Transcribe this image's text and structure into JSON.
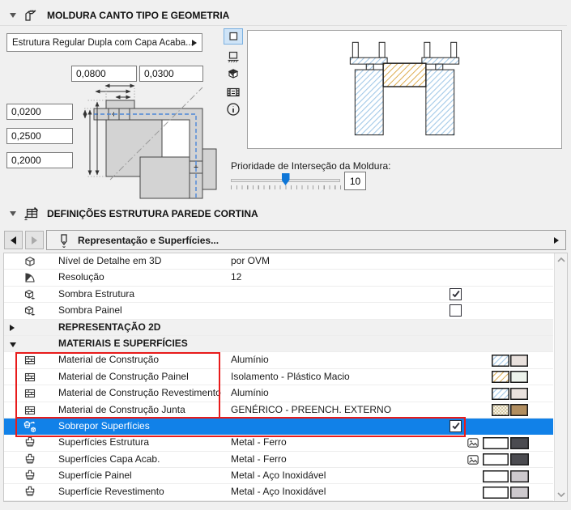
{
  "panel_moldura": {
    "title": "MOLDURA CANTO TIPO E GEOMETRIA",
    "type_selector": "Estrutura Regular Dupla com Capa Acaba...",
    "inputs": {
      "frame_width": "0,0800",
      "frame_thickness": "0,0300",
      "corner_offset": "0,0200",
      "corner_height": "0,2500",
      "corner_depth": "0,2000"
    },
    "priority": {
      "label": "Prioridade de Interseção da Moldura:",
      "value": "10",
      "percent": 50
    }
  },
  "panel_definicoes": {
    "title": "DEFINIÇÕES ESTRUTURA PAREDE CORTINA",
    "nav": {
      "label": "Representação e Superfícies..."
    },
    "table": {
      "rows": [
        {
          "icon": "cube-outline",
          "label": "Nível de Detalhe em 3D",
          "value": "por OVM"
        },
        {
          "icon": "resolution-cone",
          "label": "Resolução",
          "value": "12"
        },
        {
          "icon": "cube-shadow",
          "label": "Sombra Estrutura",
          "checkbox": true
        },
        {
          "icon": "cube-shadow",
          "label": "Sombra Painel",
          "checkbox": false
        },
        {
          "group": "collapsed",
          "label": "REPRESENTAÇÃO 2D"
        },
        {
          "group": "expanded",
          "label": "MATERIAIS E SUPERFÍCIES"
        },
        {
          "icon": "building-material",
          "label": "Material de Construção",
          "value": "Alumínio",
          "swatches": [
            "hatch-blue",
            "aluminio"
          ]
        },
        {
          "icon": "building-material",
          "label": "Material de Construção Painel",
          "value": "Isolamento - Plástico Macio",
          "swatches": [
            "hatch-orange",
            "isolamento"
          ]
        },
        {
          "icon": "building-material",
          "label": "Material de Construção Revestimento",
          "value": "Alumínio",
          "swatches": [
            "hatch-blue",
            "aluminio"
          ]
        },
        {
          "icon": "building-material",
          "label": "Material de Construção Junta",
          "value": "GENÉRICO - PREENCH. EXTERNO",
          "swatches": [
            "hatch-junta",
            "junta"
          ]
        },
        {
          "icon": "override-surfaces",
          "label": "Sobrepor Superfícies",
          "checkbox": true,
          "selected": true
        },
        {
          "icon": "paintbrush",
          "label": "Superfícies Estrutura",
          "value": "Metal - Ferro",
          "texture": true,
          "surface": [
            "white",
            "ferro"
          ]
        },
        {
          "icon": "paintbrush",
          "label": "Superfícies Capa Acab.",
          "value": "Metal - Ferro",
          "texture": true,
          "surface": [
            "white",
            "ferro"
          ]
        },
        {
          "icon": "paintbrush",
          "label": "Superfície Painel",
          "value": "Metal - Aço Inoxidável",
          "surface": [
            "white",
            "inox"
          ]
        },
        {
          "icon": "paintbrush",
          "label": "Superfície Revestimento",
          "value": "Metal - Aço Inoxidável",
          "surface": [
            "white",
            "inox"
          ]
        }
      ]
    }
  },
  "colors": {
    "selection_blue": "#1181e8",
    "annotation_red": "#e81b1b",
    "hatch_blue": "#a3c9e8",
    "hatch_orange": "#d9a23a",
    "swatch_aluminio": "#e9e1dd",
    "swatch_isolamento": "#edf3ec",
    "swatch_junta_hatch": "#d5c9a4",
    "swatch_junta": "#b18e60",
    "swatch_ferro": "#4b4b50",
    "swatch_inox": "#cdc9cd",
    "swatch_white": "#ffffff"
  }
}
